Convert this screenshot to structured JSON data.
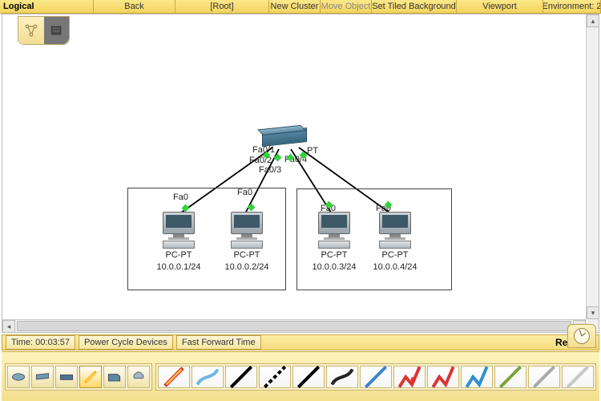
{
  "topbar": {
    "logical_label": "Logical",
    "back": "Back",
    "root": "[Root]",
    "new_cluster": "New Cluster",
    "move_object": "Move Object",
    "set_bg": "Set Tiled Background",
    "viewport": "Viewport",
    "environment": "Environment: 2"
  },
  "switch": {
    "ports": {
      "p1": "Fa0/1",
      "p2": "Fa0/2",
      "p3": "Fa0/3",
      "p4": "Fa0/4",
      "pt": "PT"
    }
  },
  "pcs": [
    {
      "iface": "Fa0",
      "type": "PC-PT",
      "ip": "10.0.0.1/24"
    },
    {
      "iface": "Fa0",
      "type": "PC-PT",
      "ip": "10.0.0.2/24"
    },
    {
      "iface": "Fa0",
      "type": "PC-PT",
      "ip": "10.0.0.3/24"
    },
    {
      "iface": "Fa0",
      "type": "PC-PT",
      "ip": "10.0.0.4/24"
    }
  ],
  "timebar": {
    "time": "Time: 00:03:57",
    "power_cycle": "Power Cycle Devices",
    "fast_forward": "Fast Forward Time",
    "realtime": "Realtime"
  },
  "palette": {
    "device_icons": [
      "router",
      "switch",
      "hub",
      "bolt",
      "folder",
      "cloud"
    ],
    "selected_device_index": 3,
    "connection_colors": [
      "#d33",
      "#f90",
      "#000",
      "#888",
      "#27b",
      "#000",
      "#000",
      "#000",
      "#d33",
      "#27b",
      "#8a5",
      "#d33",
      "#aaa"
    ]
  }
}
